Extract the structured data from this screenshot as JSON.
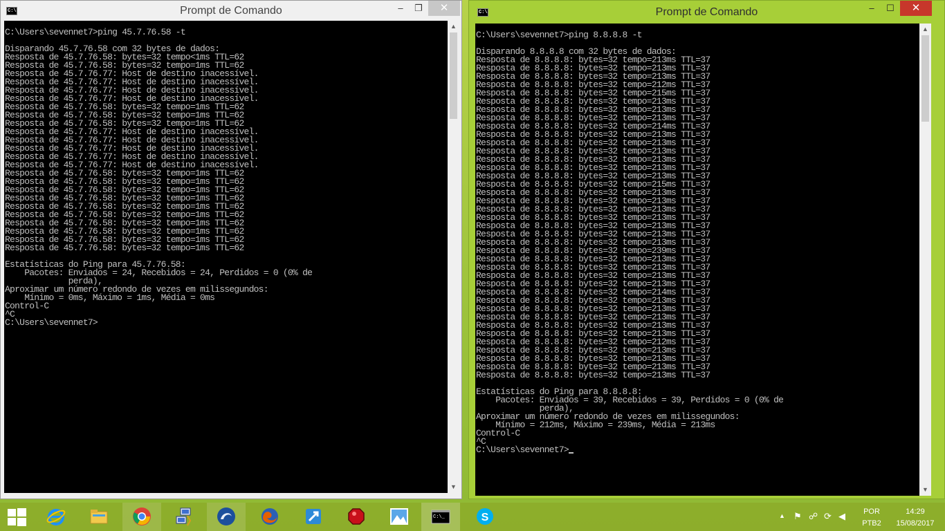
{
  "left_window": {
    "title": "Prompt de Comando",
    "controls": {
      "minimize": "–",
      "maximize": "❐",
      "close": "✕"
    },
    "icon_text": "C:\\",
    "lines": [
      "C:\\Users\\sevennet7>ping 45.7.76.58 -t",
      "",
      "Disparando 45.7.76.58 com 32 bytes de dados:",
      "Resposta de 45.7.76.58: bytes=32 tempo<1ms TTL=62",
      "Resposta de 45.7.76.58: bytes=32 tempo=1ms TTL=62",
      "Resposta de 45.7.76.77: Host de destino inacessível.",
      "Resposta de 45.7.76.77: Host de destino inacessível.",
      "Resposta de 45.7.76.77: Host de destino inacessível.",
      "Resposta de 45.7.76.77: Host de destino inacessível.",
      "Resposta de 45.7.76.58: bytes=32 tempo=1ms TTL=62",
      "Resposta de 45.7.76.58: bytes=32 tempo=1ms TTL=62",
      "Resposta de 45.7.76.58: bytes=32 tempo=1ms TTL=62",
      "Resposta de 45.7.76.77: Host de destino inacessível.",
      "Resposta de 45.7.76.77: Host de destino inacessível.",
      "Resposta de 45.7.76.77: Host de destino inacessível.",
      "Resposta de 45.7.76.77: Host de destino inacessível.",
      "Resposta de 45.7.76.77: Host de destino inacessível.",
      "Resposta de 45.7.76.58: bytes=32 tempo=1ms TTL=62",
      "Resposta de 45.7.76.58: bytes=32 tempo=1ms TTL=62",
      "Resposta de 45.7.76.58: bytes=32 tempo=1ms TTL=62",
      "Resposta de 45.7.76.58: bytes=32 tempo=1ms TTL=62",
      "Resposta de 45.7.76.58: bytes=32 tempo=1ms TTL=62",
      "Resposta de 45.7.76.58: bytes=32 tempo=1ms TTL=62",
      "Resposta de 45.7.76.58: bytes=32 tempo=1ms TTL=62",
      "Resposta de 45.7.76.58: bytes=32 tempo=1ms TTL=62",
      "Resposta de 45.7.76.58: bytes=32 tempo=1ms TTL=62",
      "Resposta de 45.7.76.58: bytes=32 tempo=1ms TTL=62",
      "",
      "Estatísticas do Ping para 45.7.76.58:",
      "    Pacotes: Enviados = 24, Recebidos = 24, Perdidos = 0 (0% de",
      "             perda),",
      "Aproximar um número redondo de vezes em milissegundos:",
      "    Mínimo = 0ms, Máximo = 1ms, Média = 0ms",
      "Control-C",
      "^C",
      "C:\\Users\\sevennet7>"
    ]
  },
  "right_window": {
    "title": "Prompt de Comando",
    "controls": {
      "minimize": "–",
      "maximize": "☐",
      "close": "✕"
    },
    "icon_text": "C:\\",
    "lines": [
      "C:\\Users\\sevennet7>ping 8.8.8.8 -t",
      "",
      "Disparando 8.8.8.8 com 32 bytes de dados:",
      "Resposta de 8.8.8.8: bytes=32 tempo=213ms TTL=37",
      "Resposta de 8.8.8.8: bytes=32 tempo=213ms TTL=37",
      "Resposta de 8.8.8.8: bytes=32 tempo=213ms TTL=37",
      "Resposta de 8.8.8.8: bytes=32 tempo=212ms TTL=37",
      "Resposta de 8.8.8.8: bytes=32 tempo=215ms TTL=37",
      "Resposta de 8.8.8.8: bytes=32 tempo=213ms TTL=37",
      "Resposta de 8.8.8.8: bytes=32 tempo=213ms TTL=37",
      "Resposta de 8.8.8.8: bytes=32 tempo=213ms TTL=37",
      "Resposta de 8.8.8.8: bytes=32 tempo=214ms TTL=37",
      "Resposta de 8.8.8.8: bytes=32 tempo=213ms TTL=37",
      "Resposta de 8.8.8.8: bytes=32 tempo=213ms TTL=37",
      "Resposta de 8.8.8.8: bytes=32 tempo=213ms TTL=37",
      "Resposta de 8.8.8.8: bytes=32 tempo=213ms TTL=37",
      "Resposta de 8.8.8.8: bytes=32 tempo=213ms TTL=37",
      "Resposta de 8.8.8.8: bytes=32 tempo=213ms TTL=37",
      "Resposta de 8.8.8.8: bytes=32 tempo=215ms TTL=37",
      "Resposta de 8.8.8.8: bytes=32 tempo=213ms TTL=37",
      "Resposta de 8.8.8.8: bytes=32 tempo=213ms TTL=37",
      "Resposta de 8.8.8.8: bytes=32 tempo=213ms TTL=37",
      "Resposta de 8.8.8.8: bytes=32 tempo=213ms TTL=37",
      "Resposta de 8.8.8.8: bytes=32 tempo=213ms TTL=37",
      "Resposta de 8.8.8.8: bytes=32 tempo=213ms TTL=37",
      "Resposta de 8.8.8.8: bytes=32 tempo=213ms TTL=37",
      "Resposta de 8.8.8.8: bytes=32 tempo=239ms TTL=37",
      "Resposta de 8.8.8.8: bytes=32 tempo=213ms TTL=37",
      "Resposta de 8.8.8.8: bytes=32 tempo=213ms TTL=37",
      "Resposta de 8.8.8.8: bytes=32 tempo=213ms TTL=37",
      "Resposta de 8.8.8.8: bytes=32 tempo=213ms TTL=37",
      "Resposta de 8.8.8.8: bytes=32 tempo=214ms TTL=37",
      "Resposta de 8.8.8.8: bytes=32 tempo=213ms TTL=37",
      "Resposta de 8.8.8.8: bytes=32 tempo=213ms TTL=37",
      "Resposta de 8.8.8.8: bytes=32 tempo=213ms TTL=37",
      "Resposta de 8.8.8.8: bytes=32 tempo=213ms TTL=37",
      "Resposta de 8.8.8.8: bytes=32 tempo=213ms TTL=37",
      "Resposta de 8.8.8.8: bytes=32 tempo=212ms TTL=37",
      "Resposta de 8.8.8.8: bytes=32 tempo=213ms TTL=37",
      "Resposta de 8.8.8.8: bytes=32 tempo=213ms TTL=37",
      "Resposta de 8.8.8.8: bytes=32 tempo=213ms TTL=37",
      "Resposta de 8.8.8.8: bytes=32 tempo=213ms TTL=37",
      "",
      "Estatísticas do Ping para 8.8.8.8:",
      "    Pacotes: Enviados = 39, Recebidos = 39, Perdidos = 0 (0% de",
      "             perda),",
      "Aproximar um número redondo de vezes em milissegundos:",
      "    Mínimo = 212ms, Máximo = 239ms, Média = 213ms",
      "Control-C",
      "^C",
      "C:\\Users\\sevennet7>"
    ]
  },
  "taskbar": {
    "items": [
      {
        "name": "start-button",
        "icon": "windows-logo-icon"
      },
      {
        "name": "internet-explorer",
        "icon": "internet-explorer-icon"
      },
      {
        "name": "file-explorer",
        "icon": "folder-icon"
      },
      {
        "name": "chrome",
        "icon": "chrome-icon"
      },
      {
        "name": "network-tool",
        "icon": "network-computer-icon"
      },
      {
        "name": "app-swirl",
        "icon": "swirl-app-icon"
      },
      {
        "name": "firefox",
        "icon": "firefox-icon"
      },
      {
        "name": "app-blue",
        "icon": "blue-app-icon"
      },
      {
        "name": "app-red",
        "icon": "red-app-icon"
      },
      {
        "name": "photos",
        "icon": "photos-icon"
      },
      {
        "name": "command-prompt",
        "icon": "command-prompt-icon"
      },
      {
        "name": "skype",
        "icon": "skype-icon"
      }
    ],
    "tray": {
      "language": "POR",
      "keyboard": "PTB2",
      "time": "14:29",
      "date": "15/08/2017"
    }
  },
  "colors": {
    "console_bg": "#000000",
    "console_text": "#c0c0c0",
    "active_titlebar": "#a7cf38",
    "close_button": "#c7372b"
  }
}
